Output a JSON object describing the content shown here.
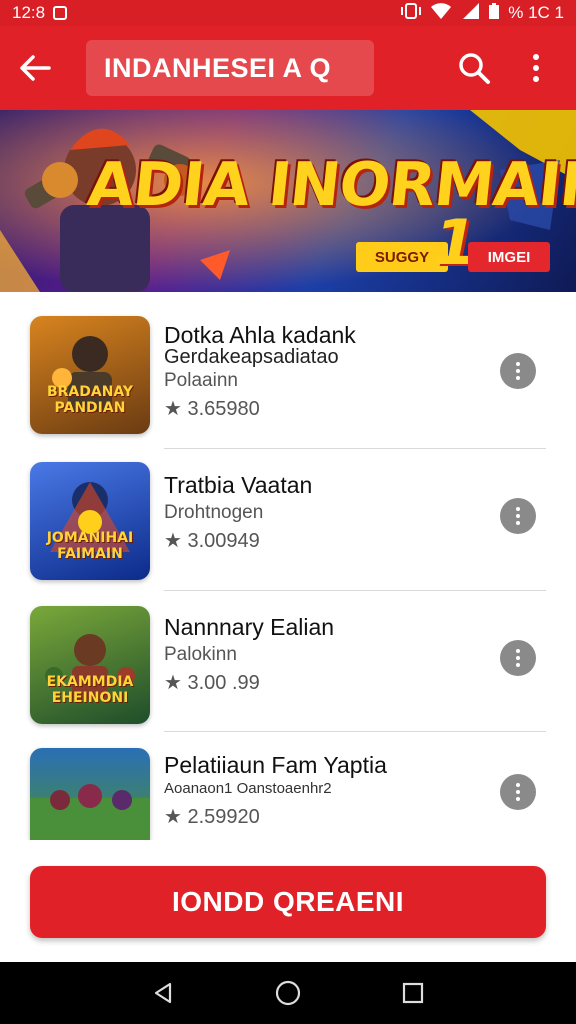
{
  "status_bar": {
    "time": "12:8",
    "right_text": "% 1C 1"
  },
  "app_bar": {
    "search_text": "INDANHESEI A Q"
  },
  "banner": {
    "title": "ADIA INORMAIN",
    "tag_left": "SUGGY",
    "tag_number": "1",
    "tag_right": "IMGEI"
  },
  "items": [
    {
      "title": "Dotka Ahla kadank",
      "subtitle_line": "Gerdakeapsadiatao",
      "category": "Polaainn",
      "rating": "3.65980",
      "thumb_text": "BRADANAY PANDIAN",
      "colors": [
        "#6a3b12",
        "#d8841f"
      ]
    },
    {
      "title": "Tratbia Vaatan",
      "subtitle_line": "",
      "category": "Drohtnogen",
      "rating": "3.00949",
      "thumb_text": "JOMANIHAI FAIMAIN",
      "colors": [
        "#0c2b8a",
        "#4a79e6"
      ]
    },
    {
      "title": "Nannnary Ealian",
      "subtitle_line": "",
      "category": "Palokinn",
      "rating": "3.00 .99",
      "thumb_text": "EKAMMDIA EHEINONI",
      "colors": [
        "#1f4d2b",
        "#7aa83a"
      ]
    },
    {
      "title": "Pelatiiaun Fam Yaptia",
      "subtitle_line": "Aoanaon1 Oanstoaenhr2",
      "category": "",
      "rating": "2.59920",
      "thumb_text": "",
      "colors": [
        "#2a6fb5",
        "#4a8f3a"
      ]
    }
  ],
  "primary_button": {
    "label": "IONDD QREAENI"
  },
  "icons": {
    "back": "arrow-left-icon",
    "search": "search-icon",
    "more": "more-vertical-icon",
    "star": "star-icon",
    "nav_back": "triangle-back-icon",
    "nav_home": "circle-home-icon",
    "nav_recents": "square-recents-icon"
  },
  "colors": {
    "brand_red": "#e02128",
    "status_red": "#d81f26"
  }
}
